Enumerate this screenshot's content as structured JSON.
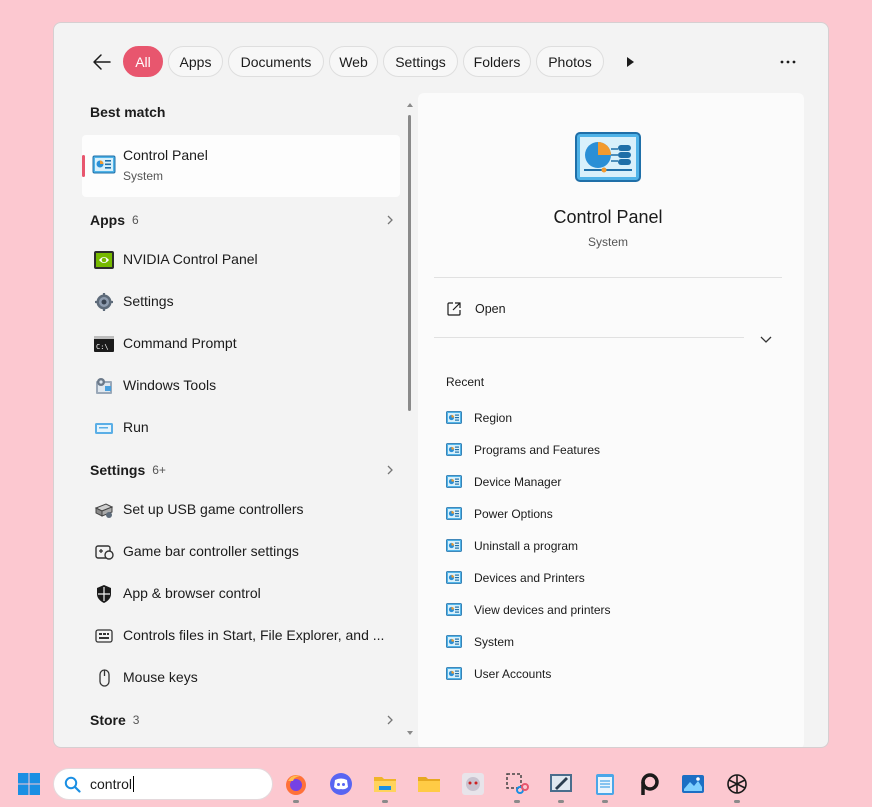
{
  "filters": {
    "items": [
      "All",
      "Apps",
      "Documents",
      "Web",
      "Settings",
      "Folders",
      "Photos"
    ],
    "active": "All"
  },
  "best_match": {
    "header": "Best match",
    "title": "Control Panel",
    "subtitle": "System"
  },
  "apps": {
    "header": "Apps",
    "count": "6",
    "items": [
      "NVIDIA Control Panel",
      "Settings",
      "Command Prompt",
      "Windows Tools",
      "Run"
    ]
  },
  "settings": {
    "header": "Settings",
    "count": "6+",
    "items": [
      "Set up USB game controllers",
      "Game bar controller settings",
      "App & browser control",
      "Controls files in Start, File Explorer, and ...",
      "Mouse keys"
    ]
  },
  "store": {
    "header": "Store",
    "count": "3"
  },
  "detail": {
    "title": "Control Panel",
    "subtitle": "System",
    "open_label": "Open",
    "recent_header": "Recent",
    "recent": [
      "Region",
      "Programs and Features",
      "Device Manager",
      "Power Options",
      "Uninstall a program",
      "Devices and Printers",
      "View devices and printers",
      "System",
      "User Accounts"
    ]
  },
  "taskbar": {
    "search_value": "control",
    "apps": [
      "firefox-icon",
      "discord-icon",
      "file-explorer-icon",
      "folder-icon",
      "anime-app-icon",
      "snipping-tool-icon",
      "paint-icon",
      "notepad-icon",
      "picsart-icon",
      "photos-icon",
      "chatgpt-icon"
    ]
  },
  "colors": {
    "accent": "#e8566e",
    "background": "#fcc8d0",
    "panel": "#f3f3f3"
  }
}
